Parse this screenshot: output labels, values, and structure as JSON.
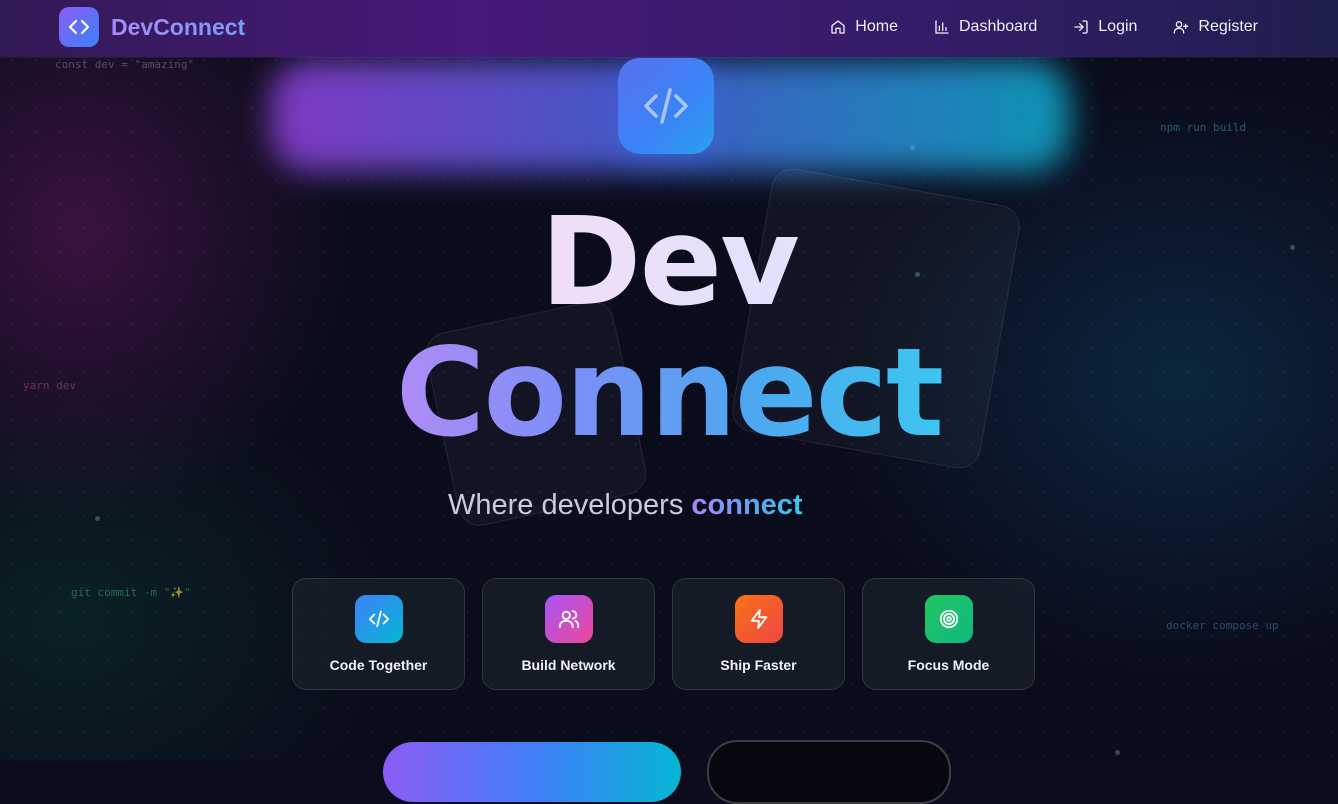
{
  "nav": {
    "brand": "DevConnect",
    "links": [
      {
        "label": "Home",
        "icon": "home-icon"
      },
      {
        "label": "Dashboard",
        "icon": "bar-chart-icon"
      },
      {
        "label": "Login",
        "icon": "login-icon"
      },
      {
        "label": "Register",
        "icon": "user-plus-icon"
      }
    ]
  },
  "background": {
    "snippets": [
      "const dev = \"amazing\"",
      "npm run build",
      "yarn dev",
      "git commit -m \"✨\"",
      "docker compose up"
    ]
  },
  "hero": {
    "icon": "code-icon",
    "title_line1": "Dev",
    "title_line2": "Connect",
    "tagline_prefix": "Where developers ",
    "tagline_highlight": "connect"
  },
  "features": [
    {
      "label": "Code Together",
      "icon": "code-icon",
      "color_from": "#3b82f6",
      "color_to": "#06b6d4"
    },
    {
      "label": "Build Network",
      "icon": "users-icon",
      "color_from": "#a855f7",
      "color_to": "#ec4899"
    },
    {
      "label": "Ship Faster",
      "icon": "zap-icon",
      "color_from": "#f97316",
      "color_to": "#ef4444"
    },
    {
      "label": "Focus Mode",
      "icon": "target-icon",
      "color_from": "#22c55e",
      "color_to": "#10b981"
    }
  ],
  "colors": {
    "accent_purple": "#8b5cf6",
    "accent_blue": "#3b82f6",
    "accent_cyan": "#06b6d4",
    "background": "#0a0c1b"
  }
}
